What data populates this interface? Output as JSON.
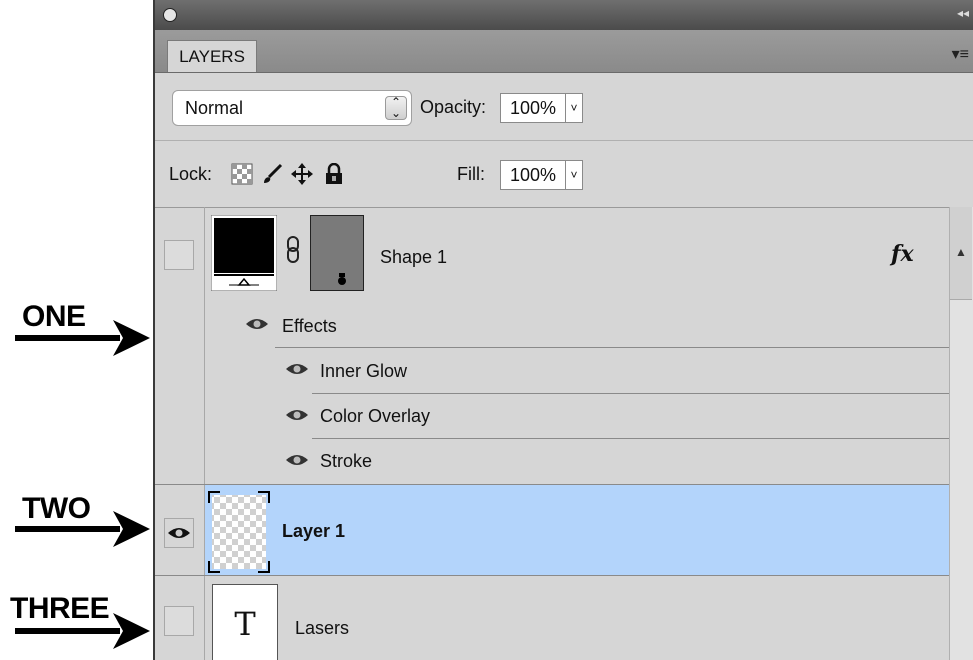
{
  "annotations": [
    {
      "label": "ONE"
    },
    {
      "label": "TWO"
    },
    {
      "label": "THREE"
    }
  ],
  "panel": {
    "tab_label": "LAYERS",
    "blend_mode": "Normal",
    "opacity_label": "Opacity:",
    "opacity_value": "100%",
    "lock_label": "Lock:",
    "fill_label": "Fill:",
    "fill_value": "100%",
    "layers": [
      {
        "name": "Shape 1",
        "fx": "fx",
        "visible": false,
        "selected": false
      },
      {
        "name": "Layer 1",
        "visible": true,
        "selected": true
      },
      {
        "name": "Lasers",
        "type_glyph": "T",
        "visible": false,
        "selected": false
      }
    ],
    "effects_header": "Effects",
    "effects": [
      "Inner Glow",
      "Color Overlay",
      "Stroke"
    ]
  },
  "colors": {
    "panel_bg": "#d6d6d6",
    "selected_row": "#b3d4fb",
    "titlebar": "#5a5a5a"
  },
  "icons": [
    "eye-icon",
    "checkerboard-icon",
    "brush-icon",
    "move-icon",
    "lock-icon",
    "link-chain-icon",
    "type-icon",
    "fx-icon",
    "panel-menu-icon",
    "spinner-icon"
  ]
}
